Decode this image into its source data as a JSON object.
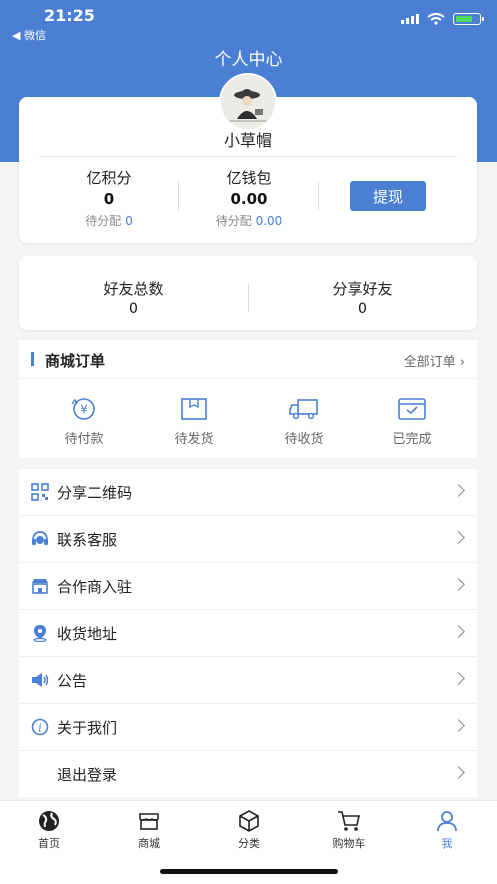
{
  "status": {
    "time": "21:25",
    "back": "◀ 微信"
  },
  "header": {
    "title": "个人中心"
  },
  "profile": {
    "username": "小草帽"
  },
  "points": {
    "label": "亿积分",
    "value": "0",
    "pending_label": "待分配",
    "pending_value": "0"
  },
  "wallet": {
    "label": "亿钱包",
    "value": "0.00",
    "pending_label": "待分配",
    "pending_value": "0.00"
  },
  "withdraw_label": "提现",
  "friends": {
    "total_label": "好友总数",
    "total_value": "0",
    "share_label": "分享好友",
    "share_value": "0"
  },
  "orders": {
    "title": "商城订单",
    "all_label": "全部订单 ›",
    "items": [
      {
        "label": "待付款",
        "icon": "payment-icon"
      },
      {
        "label": "待发货",
        "icon": "package-icon"
      },
      {
        "label": "待收货",
        "icon": "truck-icon"
      },
      {
        "label": "已完成",
        "icon": "completed-icon"
      }
    ]
  },
  "menu": [
    {
      "label": "分享二维码",
      "icon": "qrcode-icon"
    },
    {
      "label": "联系客服",
      "icon": "headset-icon"
    },
    {
      "label": "合作商入驻",
      "icon": "store-icon"
    },
    {
      "label": "收货地址",
      "icon": "location-icon"
    },
    {
      "label": "公告",
      "icon": "speaker-icon"
    },
    {
      "label": "关于我们",
      "icon": "info-icon"
    },
    {
      "label": "退出登录",
      "icon": ""
    }
  ],
  "tabs": [
    {
      "label": "首页",
      "icon": "globe-icon"
    },
    {
      "label": "商城",
      "icon": "shop-icon"
    },
    {
      "label": "分类",
      "icon": "box-icon"
    },
    {
      "label": "购物车",
      "icon": "cart-icon"
    },
    {
      "label": "我",
      "icon": "user-icon"
    }
  ],
  "colors": {
    "accent": "#4a7fd4",
    "background": "#f3f4f6"
  }
}
